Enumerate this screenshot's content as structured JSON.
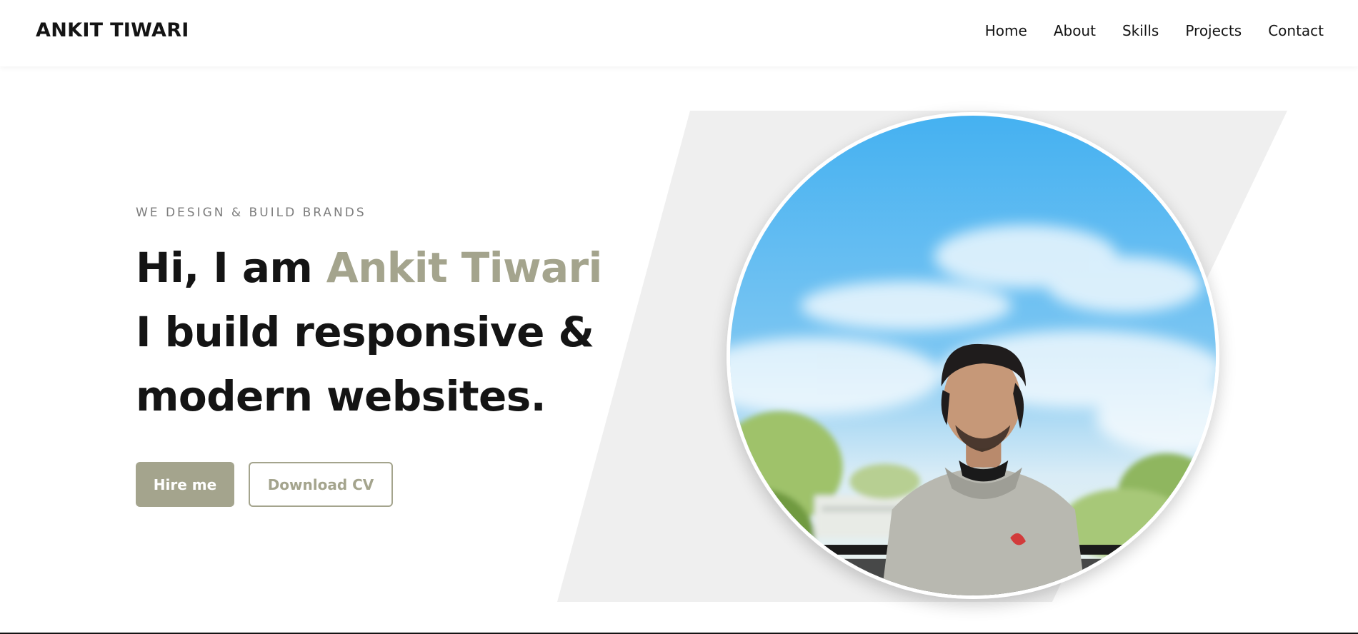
{
  "header": {
    "brand": "ANKIT TIWARI",
    "nav": [
      "Home",
      "About",
      "Skills",
      "Projects",
      "Contact"
    ]
  },
  "hero": {
    "eyebrow": "WE DESIGN & BUILD BRANDS",
    "greeting": "Hi, I am ",
    "name": "Ankit Tiwari",
    "line2": "I build responsive &",
    "line3": "modern websites.",
    "hire_label": "Hire me",
    "cv_label": "Download CV"
  },
  "colors": {
    "accent": "#a4a48d",
    "text": "#141414",
    "muted": "#7d7d7d",
    "panel": "#efefef"
  }
}
